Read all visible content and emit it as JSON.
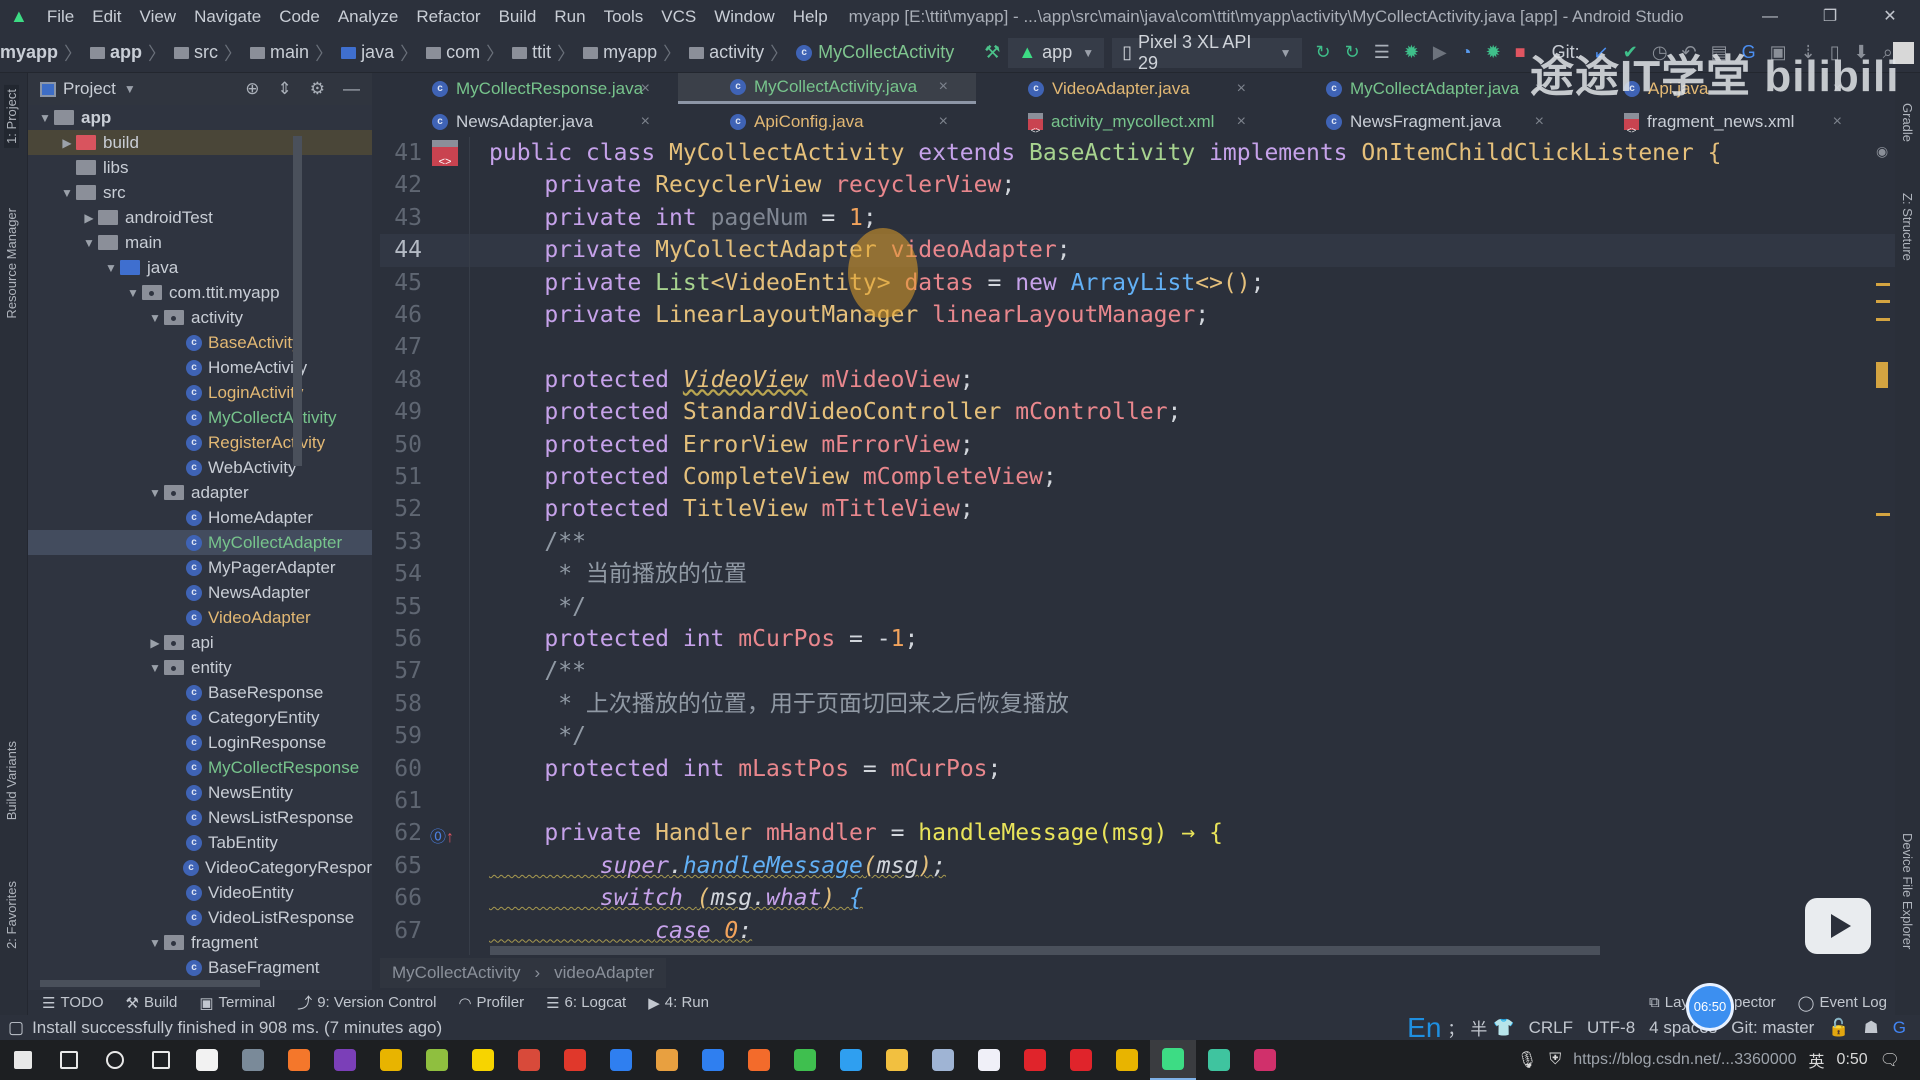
{
  "titlebar": {
    "menus": [
      "File",
      "Edit",
      "View",
      "Navigate",
      "Code",
      "Analyze",
      "Refactor",
      "Build",
      "Run",
      "Tools",
      "VCS",
      "Window",
      "Help"
    ],
    "title": "myapp [E:\\ttit\\myapp] - ...\\app\\src\\main\\java\\com\\ttit\\myapp\\activity\\MyCollectActivity.java [app] - Android Studio",
    "window_controls": [
      "—",
      "❐",
      "✕"
    ]
  },
  "navbar": {
    "crumbs": [
      "myapp",
      "app",
      "src",
      "main",
      "java",
      "com",
      "ttit",
      "myapp",
      "activity",
      "MyCollectActivity"
    ],
    "run_config": "app",
    "device": "Pixel 3 XL API 29",
    "git_label": "Git:"
  },
  "left_strip": [
    "1: Project",
    "Resource Manager",
    "Build Variants",
    "2: Favorites"
  ],
  "right_strip": [
    "Gradle",
    "Z: Structure",
    "Device File Explorer"
  ],
  "project": {
    "title": "Project",
    "tree": [
      {
        "label": "app",
        "depth": 0,
        "kind": "module",
        "arrow": "down",
        "status": "normal"
      },
      {
        "label": "build",
        "depth": 1,
        "kind": "folder-red",
        "arrow": "right",
        "status": "normal",
        "highlight": true
      },
      {
        "label": "libs",
        "depth": 1,
        "kind": "folder",
        "arrow": "",
        "status": "normal"
      },
      {
        "label": "src",
        "depth": 1,
        "kind": "folder",
        "arrow": "down",
        "status": "normal"
      },
      {
        "label": "androidTest",
        "depth": 2,
        "kind": "folder",
        "arrow": "right",
        "status": "normal"
      },
      {
        "label": "main",
        "depth": 2,
        "kind": "folder",
        "arrow": "down",
        "status": "normal"
      },
      {
        "label": "java",
        "depth": 3,
        "kind": "folder-blue",
        "arrow": "down",
        "status": "normal"
      },
      {
        "label": "com.ttit.myapp",
        "depth": 4,
        "kind": "package",
        "arrow": "down",
        "status": "normal"
      },
      {
        "label": "activity",
        "depth": 5,
        "kind": "package",
        "arrow": "down",
        "status": "normal"
      },
      {
        "label": "BaseActivity",
        "depth": 6,
        "kind": "class",
        "status": "modified"
      },
      {
        "label": "HomeActivity",
        "depth": 6,
        "kind": "class",
        "status": "normal"
      },
      {
        "label": "LoginActivity",
        "depth": 6,
        "kind": "class",
        "status": "modified"
      },
      {
        "label": "MyCollectActivity",
        "depth": 6,
        "kind": "class",
        "status": "new"
      },
      {
        "label": "RegisterActivity",
        "depth": 6,
        "kind": "class",
        "status": "modified"
      },
      {
        "label": "WebActivity",
        "depth": 6,
        "kind": "class",
        "status": "normal"
      },
      {
        "label": "adapter",
        "depth": 5,
        "kind": "package",
        "arrow": "down",
        "status": "normal"
      },
      {
        "label": "HomeAdapter",
        "depth": 6,
        "kind": "class",
        "status": "normal"
      },
      {
        "label": "MyCollectAdapter",
        "depth": 6,
        "kind": "class",
        "status": "new",
        "selected": true
      },
      {
        "label": "MyPagerAdapter",
        "depth": 6,
        "kind": "class",
        "status": "normal"
      },
      {
        "label": "NewsAdapter",
        "depth": 6,
        "kind": "class",
        "status": "normal"
      },
      {
        "label": "VideoAdapter",
        "depth": 6,
        "kind": "class",
        "status": "modified"
      },
      {
        "label": "api",
        "depth": 5,
        "kind": "package",
        "arrow": "right",
        "status": "normal"
      },
      {
        "label": "entity",
        "depth": 5,
        "kind": "package",
        "arrow": "down",
        "status": "normal"
      },
      {
        "label": "BaseResponse",
        "depth": 6,
        "kind": "class",
        "status": "normal"
      },
      {
        "label": "CategoryEntity",
        "depth": 6,
        "kind": "class",
        "status": "normal"
      },
      {
        "label": "LoginResponse",
        "depth": 6,
        "kind": "class",
        "status": "normal"
      },
      {
        "label": "MyCollectResponse",
        "depth": 6,
        "kind": "class",
        "status": "new"
      },
      {
        "label": "NewsEntity",
        "depth": 6,
        "kind": "class",
        "status": "normal"
      },
      {
        "label": "NewsListResponse",
        "depth": 6,
        "kind": "class",
        "status": "normal"
      },
      {
        "label": "TabEntity",
        "depth": 6,
        "kind": "class",
        "status": "normal"
      },
      {
        "label": "VideoCategoryRespor",
        "depth": 6,
        "kind": "class",
        "status": "normal"
      },
      {
        "label": "VideoEntity",
        "depth": 6,
        "kind": "class",
        "status": "normal"
      },
      {
        "label": "VideoListResponse",
        "depth": 6,
        "kind": "class",
        "status": "normal"
      },
      {
        "label": "fragment",
        "depth": 5,
        "kind": "package",
        "arrow": "down",
        "status": "normal"
      },
      {
        "label": "BaseFragment",
        "depth": 6,
        "kind": "class",
        "status": "normal"
      }
    ]
  },
  "tabs": {
    "row1": [
      {
        "label": "MyCollectResponse.java",
        "type": "class",
        "status": "new"
      },
      {
        "label": "MyCollectActivity.java",
        "type": "class",
        "status": "new",
        "active": true
      },
      {
        "label": "VideoAdapter.java",
        "type": "class",
        "status": "modified"
      },
      {
        "label": "MyCollectAdapter.java",
        "type": "class",
        "status": "new"
      },
      {
        "label": "Api.java",
        "type": "class",
        "status": "modified"
      }
    ],
    "row2": [
      {
        "label": "NewsAdapter.java",
        "type": "class",
        "status": "normal"
      },
      {
        "label": "ApiConfig.java",
        "type": "class",
        "status": "modified"
      },
      {
        "label": "activity_mycollect.xml",
        "type": "xml",
        "status": "new"
      },
      {
        "label": "NewsFragment.java",
        "type": "class",
        "status": "normal"
      },
      {
        "label": "fragment_news.xml",
        "type": "xml",
        "status": "normal"
      }
    ],
    "close_glyph": "×"
  },
  "editor": {
    "current_line": 44,
    "lines": [
      {
        "n": "41",
        "t": [
          [
            "kw",
            "public class "
          ],
          [
            "type",
            "MyCollectActivity "
          ],
          [
            "kw",
            "extends "
          ],
          [
            "grn",
            "BaseActivity "
          ],
          [
            "kw",
            "implements "
          ],
          [
            "type",
            "OnItemChildClickListener "
          ],
          [
            "type",
            "{"
          ]
        ]
      },
      {
        "n": "42",
        "t": [
          [
            "p",
            "    "
          ],
          [
            "kw",
            "private "
          ],
          [
            "type",
            "RecyclerView "
          ],
          [
            "field",
            "recyclerView"
          ],
          [
            "p",
            ";"
          ]
        ]
      },
      {
        "n": "43",
        "t": [
          [
            "p",
            "    "
          ],
          [
            "kw",
            "private int "
          ],
          [
            "unused",
            "pageNum"
          ],
          [
            "p",
            " = "
          ],
          [
            "num",
            "1"
          ],
          [
            "p",
            ";"
          ]
        ]
      },
      {
        "n": "44",
        "t": [
          [
            "p",
            "    "
          ],
          [
            "kw",
            "private "
          ],
          [
            "type",
            "MyCollectAdapter"
          ],
          [
            "field",
            " videoAdapter"
          ],
          [
            "p",
            ";"
          ]
        ]
      },
      {
        "n": "45",
        "t": [
          [
            "p",
            "    "
          ],
          [
            "kw",
            "private "
          ],
          [
            "grn",
            "List"
          ],
          [
            "type",
            "<VideoEntity> "
          ],
          [
            "field",
            "datas"
          ],
          [
            "p",
            " = "
          ],
          [
            "kw",
            "new "
          ],
          [
            "blu",
            "ArrayList"
          ],
          [
            "type",
            "<>()"
          ],
          [
            "p",
            ";"
          ]
        ]
      },
      {
        "n": "46",
        "t": [
          [
            "p",
            "    "
          ],
          [
            "kw",
            "private "
          ],
          [
            "type",
            "LinearLayoutManager "
          ],
          [
            "field",
            "linearLayoutManager"
          ],
          [
            "p",
            ";"
          ]
        ]
      },
      {
        "n": "47",
        "t": []
      },
      {
        "n": "48",
        "t": [
          [
            "p",
            "    "
          ],
          [
            "kw",
            "protected "
          ],
          [
            "type it ul",
            "VideoView"
          ],
          [
            "field",
            " mVideoView"
          ],
          [
            "p",
            ";"
          ]
        ]
      },
      {
        "n": "49",
        "t": [
          [
            "p",
            "    "
          ],
          [
            "kw",
            "protected "
          ],
          [
            "type",
            "StandardVideoController "
          ],
          [
            "field",
            "mController"
          ],
          [
            "p",
            ";"
          ]
        ]
      },
      {
        "n": "50",
        "t": [
          [
            "p",
            "    "
          ],
          [
            "kw",
            "protected "
          ],
          [
            "type",
            "ErrorView "
          ],
          [
            "field",
            "mErrorView"
          ],
          [
            "p",
            ";"
          ]
        ]
      },
      {
        "n": "51",
        "t": [
          [
            "p",
            "    "
          ],
          [
            "kw",
            "protected "
          ],
          [
            "type",
            "CompleteView "
          ],
          [
            "field",
            "mCompleteView"
          ],
          [
            "p",
            ";"
          ]
        ]
      },
      {
        "n": "52",
        "t": [
          [
            "p",
            "    "
          ],
          [
            "kw",
            "protected "
          ],
          [
            "type",
            "TitleView "
          ],
          [
            "field",
            "mTitleView"
          ],
          [
            "p",
            ";"
          ]
        ]
      },
      {
        "n": "53",
        "t": [
          [
            "cm",
            "    /**"
          ]
        ]
      },
      {
        "n": "54",
        "t": [
          [
            "cm",
            "     * 当前播放的位置"
          ]
        ]
      },
      {
        "n": "55",
        "t": [
          [
            "cm",
            "     */"
          ]
        ]
      },
      {
        "n": "56",
        "t": [
          [
            "p",
            "    "
          ],
          [
            "kw",
            "protected int "
          ],
          [
            "field",
            "mCurPos"
          ],
          [
            "p",
            " = -"
          ],
          [
            "num",
            "1"
          ],
          [
            "p",
            ";"
          ]
        ]
      },
      {
        "n": "57",
        "t": [
          [
            "cm",
            "    /**"
          ]
        ]
      },
      {
        "n": "58",
        "t": [
          [
            "cm",
            "     * 上次播放的位置，用于页面切回来之后恢复播放"
          ]
        ]
      },
      {
        "n": "59",
        "t": [
          [
            "cm",
            "     */"
          ]
        ]
      },
      {
        "n": "60",
        "t": [
          [
            "p",
            "    "
          ],
          [
            "kw",
            "protected int "
          ],
          [
            "field",
            "mLastPos"
          ],
          [
            "p",
            " = "
          ],
          [
            "field",
            "mCurPos"
          ],
          [
            "p",
            ";"
          ]
        ]
      },
      {
        "n": "61",
        "t": []
      },
      {
        "n": "62",
        "t": [
          [
            "p",
            "    "
          ],
          [
            "kw",
            "private "
          ],
          [
            "type",
            "Handler "
          ],
          [
            "field",
            "mHandler"
          ],
          [
            "p",
            " = "
          ],
          [
            "fn",
            "handleMessage(msg) → {"
          ]
        ]
      },
      {
        "n": "65",
        "warn": true,
        "t": [
          [
            "p",
            "        "
          ],
          [
            "kw it",
            "super"
          ],
          [
            "p it",
            "."
          ],
          [
            "fnb",
            "handleMessage"
          ],
          [
            "type it",
            "("
          ],
          [
            "p it",
            "msg"
          ],
          [
            "type it",
            ")"
          ],
          [
            "p it",
            ";"
          ]
        ]
      },
      {
        "n": "66",
        "warn": true,
        "t": [
          [
            "p",
            "        "
          ],
          [
            "kw it",
            "switch "
          ],
          [
            "type it",
            "("
          ],
          [
            "p it",
            "msg."
          ],
          [
            "kw it",
            "what"
          ],
          [
            "type it",
            ") "
          ],
          [
            "blu it",
            "{"
          ]
        ]
      },
      {
        "n": "67",
        "warn": true,
        "t": [
          [
            "p",
            "            "
          ],
          [
            "kw it",
            "case "
          ],
          [
            "num it",
            "0"
          ],
          [
            "p it",
            ":"
          ]
        ]
      }
    ]
  },
  "breadcrumb": [
    "MyCollectActivity",
    "videoAdapter"
  ],
  "toolwindows": {
    "left": [
      "TODO",
      "Build",
      "Terminal",
      "9: Version Control",
      "Profiler",
      "6: Logcat",
      "4: Run"
    ],
    "right": [
      "Layout Inspector",
      "Event Log"
    ]
  },
  "status": {
    "message": "Install successfully finished in 908 ms. (7 minutes ago)",
    "ime": [
      "En",
      "；",
      "半"
    ],
    "line_sep": "CRLF",
    "encoding": "UTF-8",
    "indent": "4 spaces",
    "git": "Git: master"
  },
  "overlay": {
    "watermark": "途途IT学堂 bilibili",
    "timer": "06:50"
  },
  "taskbar": {
    "tray_text": "https://blog.csdn.net/...3360000",
    "ime": "英",
    "clock": "0:50"
  }
}
